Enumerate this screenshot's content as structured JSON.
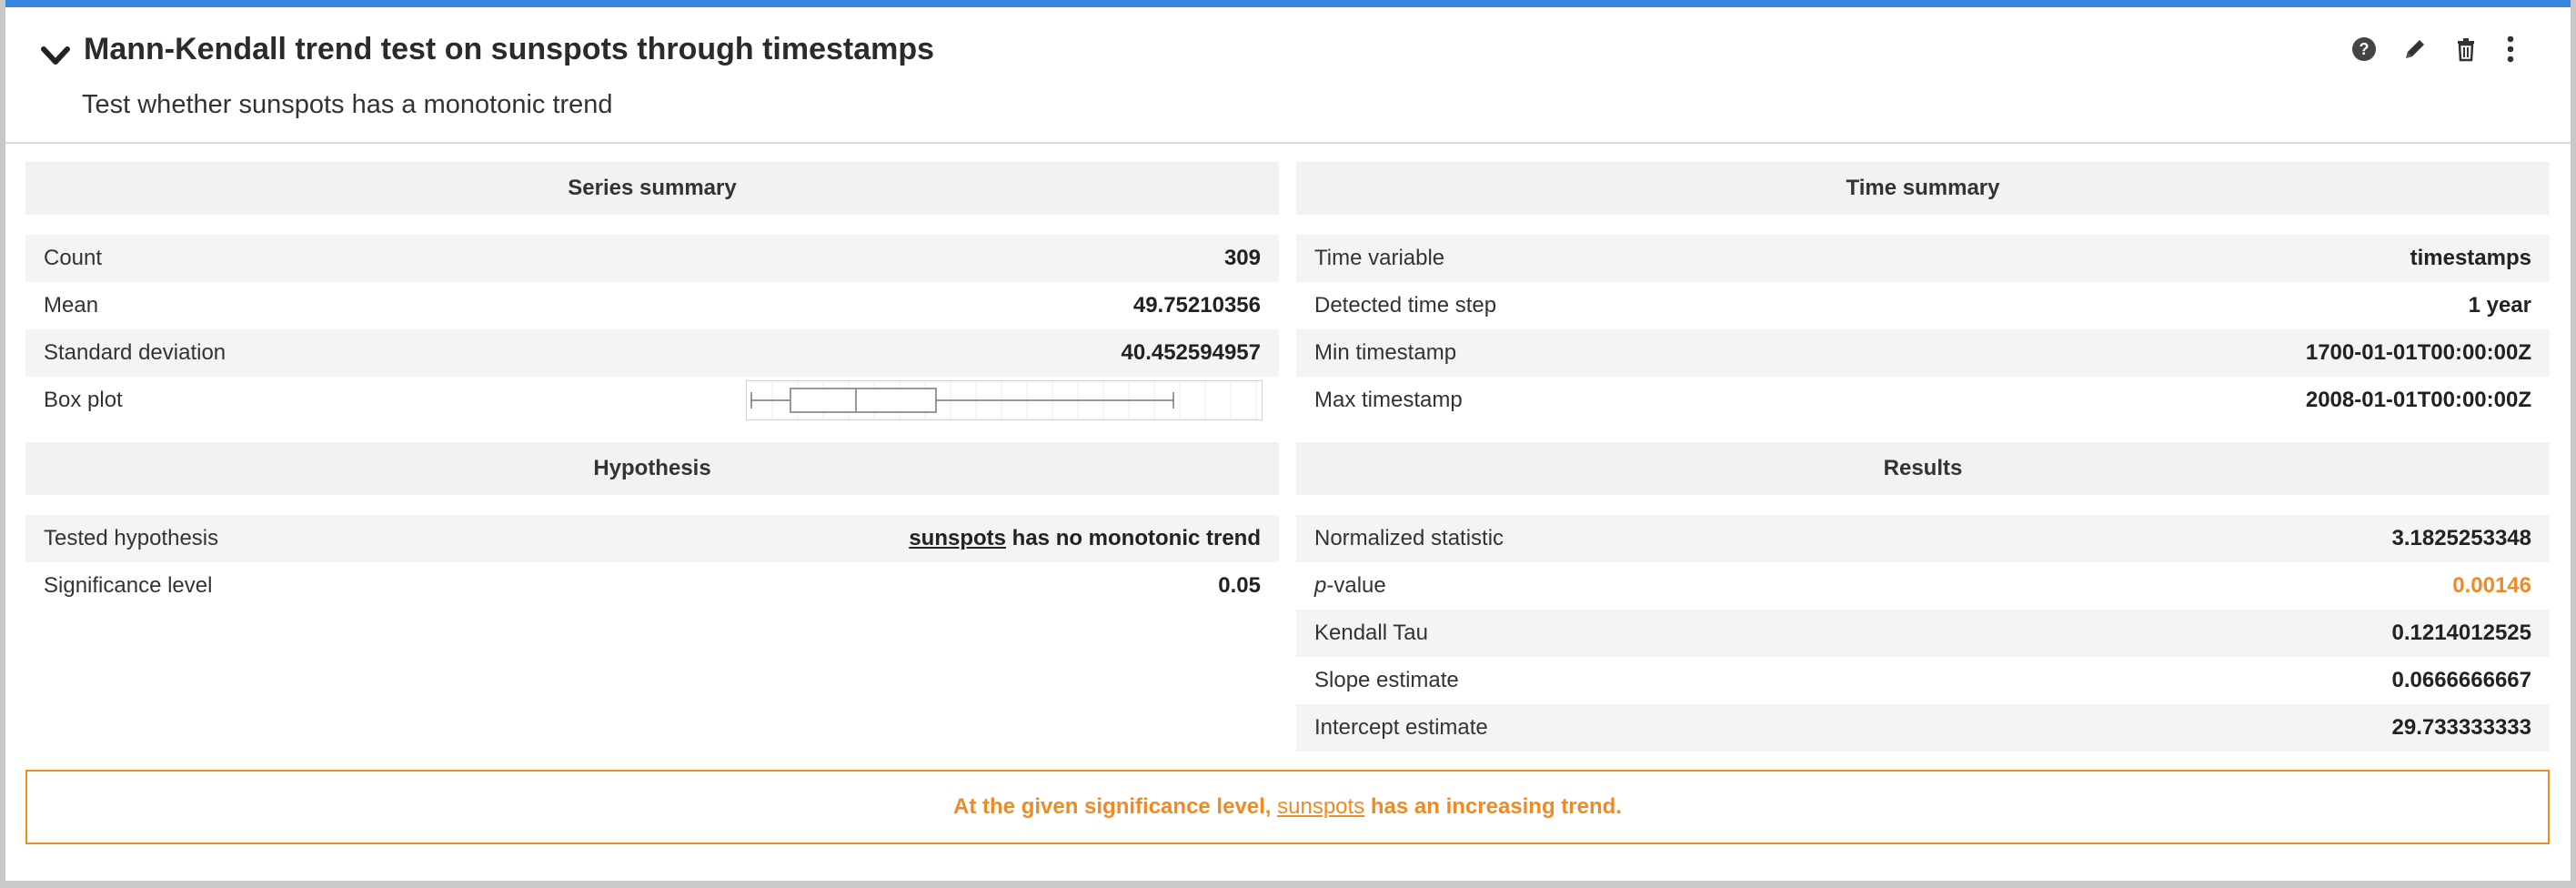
{
  "header": {
    "title": "Mann-Kendall trend test on sunspots through timestamps",
    "subtitle": "Test whether sunspots has a monotonic trend"
  },
  "series_summary": {
    "title": "Series summary",
    "rows": [
      {
        "label": "Count",
        "value": "309"
      },
      {
        "label": "Mean",
        "value": "49.75210356"
      },
      {
        "label": "Standard deviation",
        "value": "40.452594957"
      },
      {
        "label": "Box plot",
        "value": ""
      }
    ]
  },
  "time_summary": {
    "title": "Time summary",
    "rows": [
      {
        "label": "Time variable",
        "value": "timestamps"
      },
      {
        "label": "Detected time step",
        "value": "1 year"
      },
      {
        "label": "Min timestamp",
        "value": "1700-01-01T00:00:00Z"
      },
      {
        "label": "Max timestamp",
        "value": "2008-01-01T00:00:00Z"
      }
    ]
  },
  "hypothesis": {
    "title": "Hypothesis",
    "tested_label": "Tested hypothesis",
    "tested_var": "sunspots",
    "tested_rest": " has no monotonic trend",
    "significance_label": "Significance level",
    "significance_value": "0.05"
  },
  "results": {
    "title": "Results",
    "rows": [
      {
        "label": "Normalized statistic",
        "value": "3.1825253348"
      },
      {
        "label_italic": "p",
        "label": "-value",
        "value": "0.00146"
      },
      {
        "label": "Kendall Tau",
        "value": "0.1214012525"
      },
      {
        "label": "Slope estimate",
        "value": "0.0666666667"
      },
      {
        "label": "Intercept estimate",
        "value": "29.733333333"
      }
    ]
  },
  "conclusion": {
    "prefix": "At the given significance level, ",
    "var": "sunspots",
    "middle": " has ",
    "result": "an increasing trend."
  },
  "colors": {
    "accent_top": "#3b86e0",
    "highlight": "#f08a24"
  },
  "icons": [
    "chevron-down-icon",
    "help-icon",
    "pencil-icon",
    "trash-icon",
    "more-vertical-icon"
  ]
}
